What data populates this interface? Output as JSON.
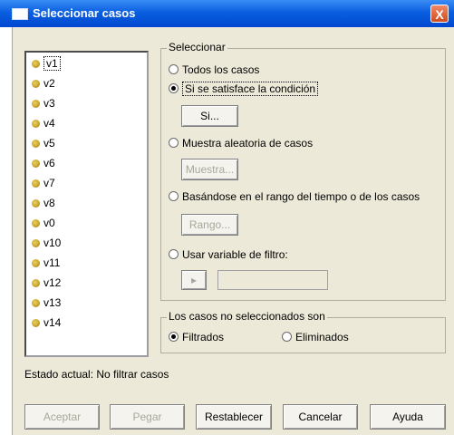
{
  "window": {
    "title": "Seleccionar casos",
    "close_glyph": "X"
  },
  "variables": [
    "v1",
    "v2",
    "v3",
    "v4",
    "v5",
    "v6",
    "v7",
    "v8",
    "v0",
    "v10",
    "v11",
    "v12",
    "v13",
    "v14"
  ],
  "select_group": {
    "legend": "Seleccionar",
    "options": [
      {
        "label": "Todos los casos",
        "checked": false
      },
      {
        "label": "Si se satisface la condición",
        "checked": true
      },
      {
        "label": "Muestra aleatoria de casos",
        "checked": false
      },
      {
        "label": "Basándose en el rango del tiempo o de los casos",
        "checked": false
      },
      {
        "label": "Usar variable de filtro:",
        "checked": false
      }
    ],
    "if_button": "Si...",
    "sample_button": "Muestra...",
    "range_button": "Rango...",
    "arrow_glyph": "▸",
    "filter_value": ""
  },
  "unselected_group": {
    "legend": "Los casos no seleccionados son",
    "options": [
      {
        "label": "Filtrados",
        "checked": true
      },
      {
        "label": "Eliminados",
        "checked": false
      }
    ]
  },
  "status": {
    "text": "Estado actual: No filtrar casos"
  },
  "buttons": {
    "ok": "Aceptar",
    "paste": "Pegar",
    "reset": "Restablecer",
    "cancel": "Cancelar",
    "help": "Ayuda"
  },
  "colors": {
    "titlebar": "#0a5fe0",
    "dialog_bg": "#ece9d8",
    "close": "#d14b1e"
  },
  "icons": {
    "variable": "scale-variable-icon",
    "window": "window-icon",
    "close": "close-icon"
  }
}
